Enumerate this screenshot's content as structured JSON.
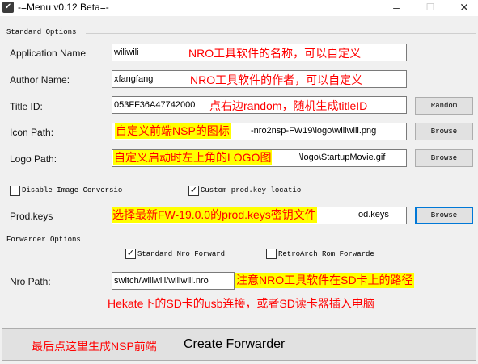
{
  "window": {
    "title": "-=Menu v0.12 Beta=-",
    "minimize": "–",
    "maximize": "☐",
    "close": "✕"
  },
  "standard": {
    "heading": "Standard Options",
    "app_name": {
      "label": "Application Name",
      "value": "wiliwili",
      "note": "NRO工具软件的名称，可以自定义"
    },
    "author": {
      "label": "Author Name:",
      "value": "xfangfang",
      "note": "NRO工具软件的作者，可以自定义"
    },
    "title_id": {
      "label": "Title ID:",
      "value": "053FF36A47742000",
      "note": "点右边random，随机生成titleID",
      "button": "Random"
    },
    "icon": {
      "label": "Icon Path:",
      "note": "自定义前端NSP的图标",
      "value_tail": "-nro2nsp-FW19\\logo\\wiliwili.png",
      "button": "Browse"
    },
    "logo": {
      "label": "Logo Path:",
      "note": "自定义启动时左上角的LOGO图",
      "value_tail": "\\logo\\StartupMovie.gif",
      "button": "Browse"
    },
    "disable_image": {
      "label": "Disable Image Conversio",
      "checked": false
    },
    "custom_prodkey": {
      "label": "Custom prod.key locatio",
      "checked": true
    },
    "prodkeys": {
      "label": "Prod.keys",
      "note": "选择最新FW-19.0.0的prod.keys密钥文件",
      "value_tail": "od.keys",
      "button": "Browse"
    }
  },
  "forwarder": {
    "heading": "Forwarder Options",
    "standard_nro": {
      "label": "Standard Nro Forward",
      "checked": true
    },
    "retroarch": {
      "label": "RetroArch Rom Forwarde",
      "checked": false
    },
    "nro_path": {
      "label": "Nro Path:",
      "value": "switch/wiliwili/wiliwili.nro",
      "note": "注意NRO工具软件在SD卡上的路径",
      "note2": "Hekate下的SD卡的usb连接，或者SD读卡器插入电脑"
    }
  },
  "bottom": {
    "note": "最后点这里生成NSP前端",
    "create_button": "Create Forwarder"
  },
  "colors": {
    "annotation_red": "#ff0000",
    "highlight_yellow": "#ffff00",
    "focus_blue": "#0078d7"
  }
}
